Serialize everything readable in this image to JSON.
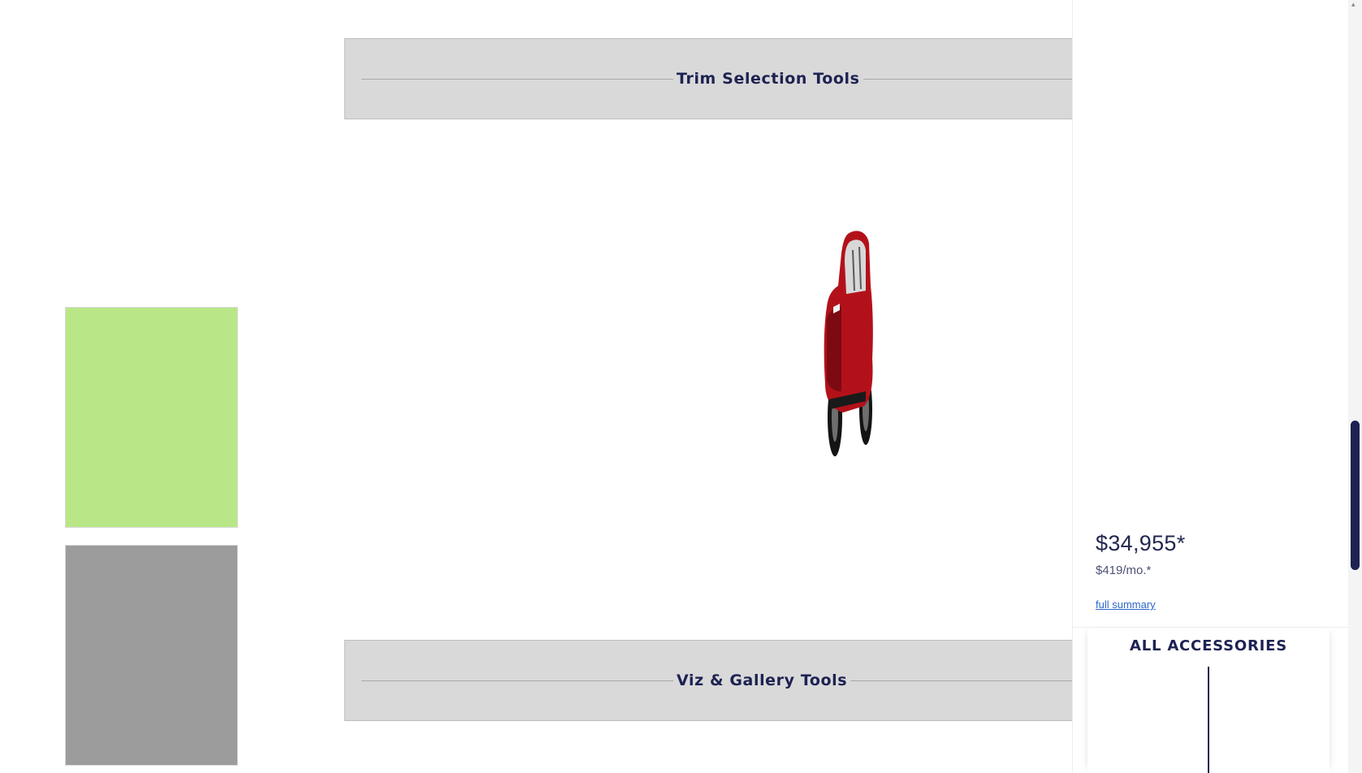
{
  "swatches": [
    {
      "name": "green",
      "color": "#b9e788"
    },
    {
      "name": "gray",
      "color": "#9c9c9c"
    }
  ],
  "panels": {
    "trim_title": "Trim Selection Tools",
    "viz_title": "Viz & Gallery Tools"
  },
  "vehicle": {
    "color": "#b3111a",
    "icon": "car-side-icon"
  },
  "summary": {
    "price": "$34,955*",
    "monthly": "$419/mo.*",
    "full_summary_link": "full summary"
  },
  "accessories": {
    "title": "ALL ACCESSORIES"
  },
  "colors": {
    "navy": "#1d2252",
    "panel_bg": "#d9d9d9",
    "link": "#2d66c6"
  }
}
